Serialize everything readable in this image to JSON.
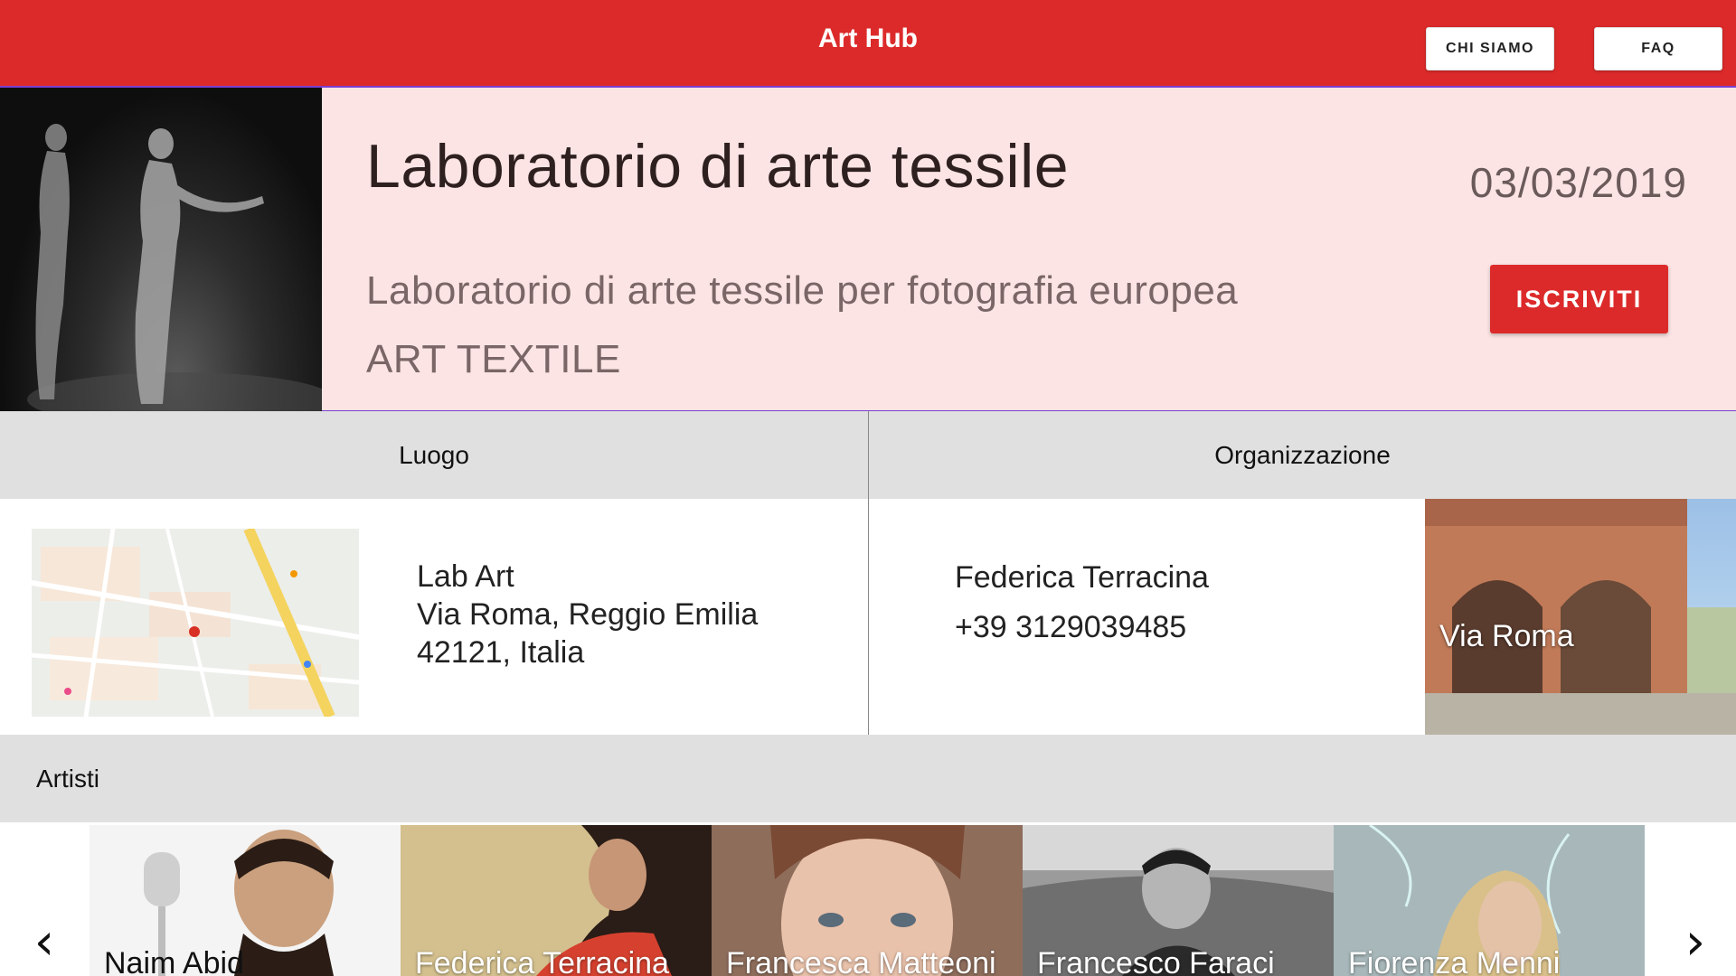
{
  "header": {
    "title": "Art Hub",
    "nav": [
      "CHI SIAMO",
      "FAQ"
    ],
    "color": "#dc2a2a"
  },
  "event": {
    "title": "Laboratorio di arte tessile",
    "date": "03/03/2019",
    "description": "Laboratorio di arte tessile per fotografia europea",
    "category": "ART TEXTILE",
    "cta": "ISCRIVITI",
    "background": "#fce4e4"
  },
  "luogo": {
    "heading": "Luogo",
    "lines": [
      "Lab Art",
      "Via Roma, Reggio Emilia",
      "42121, Italia"
    ]
  },
  "organizzazione": {
    "heading": "Organizzazione",
    "name": "Federica Terracina",
    "phone": "+39 3129039485",
    "place_label": "Via Roma"
  },
  "artisti": {
    "heading": "Artisti",
    "prev_icon": "chevron-left-icon",
    "next_icon": "chevron-right-icon",
    "items": [
      {
        "name": "Naim Abid"
      },
      {
        "name": "Federica Terracina"
      },
      {
        "name": "Francesca Matteoni"
      },
      {
        "name": "Francesco Faraci"
      },
      {
        "name": "Fiorenza Menni"
      }
    ]
  }
}
